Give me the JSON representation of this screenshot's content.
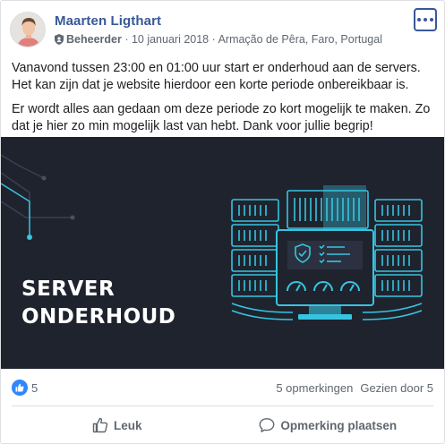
{
  "post": {
    "author": "Maarten Ligthart",
    "role": "Beheerder",
    "date": "10 januari 2018",
    "location": "Armação de Pêra, Faro, Portugal",
    "separator": " · ",
    "paragraph1": "Vanavond tussen 23:00 en 01:00 uur start er onderhoud aan de servers. Het kan zijn dat je website hierdoor een korte periode onbereikbaar is.",
    "paragraph2": "Er wordt alles aan gedaan om deze periode zo kort mogelijk te maken. Zo dat je hier zo min mogelijk last van hebt. Dank voor jullie begrip!"
  },
  "image": {
    "line1": "SERVER",
    "line2": "ONDERHOUD",
    "accent_color": "#36c5e0",
    "background_color": "#1f232e"
  },
  "stats": {
    "likes": "5",
    "comments": "5 opmerkingen",
    "views": "Gezien door 5"
  },
  "actions": {
    "like": "Leuk",
    "comment": "Opmerking plaatsen"
  },
  "icons": {
    "more": "more-options-icon",
    "role": "shield-icon",
    "like_reaction": "thumbs-up-icon",
    "like_action": "thumbs-up-outline-icon",
    "comment_action": "speech-bubble-icon"
  },
  "colors": {
    "link": "#385898",
    "like_blue": "#2d88ff",
    "muted": "#606770"
  }
}
